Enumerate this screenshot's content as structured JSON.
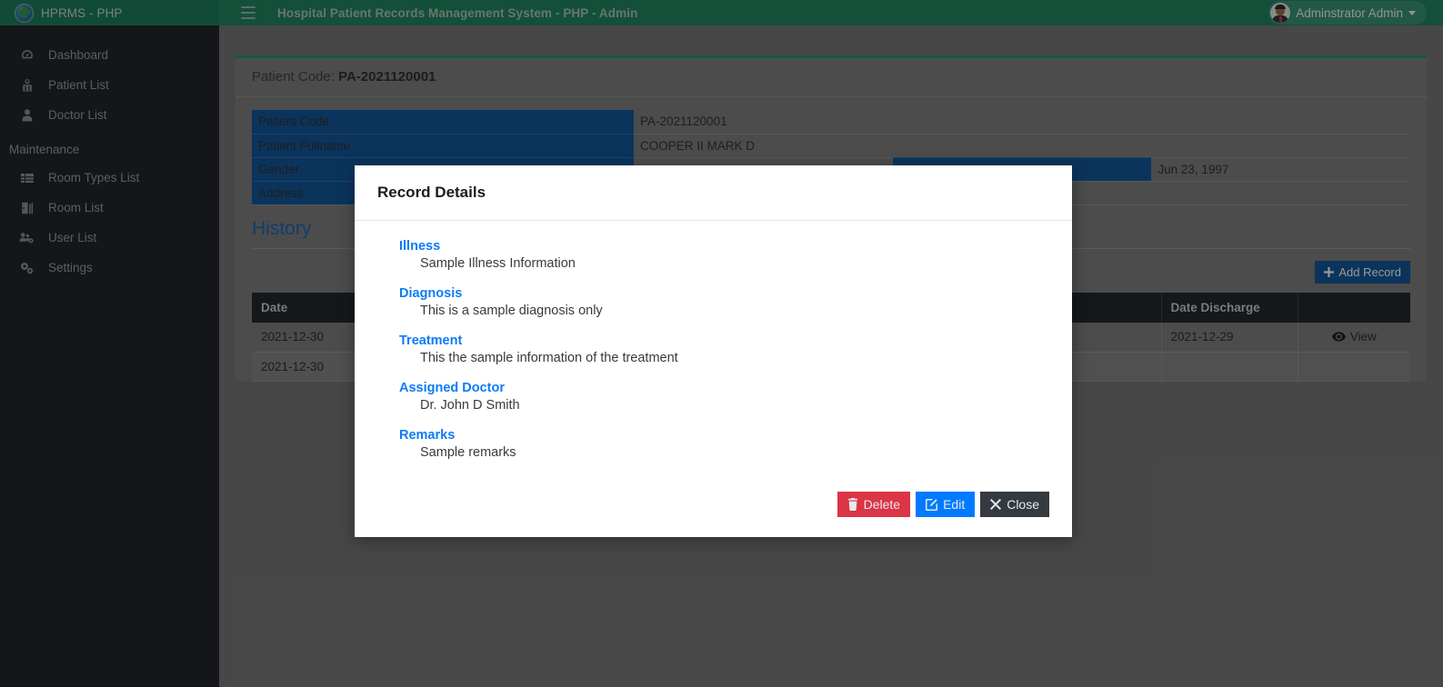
{
  "navbar": {
    "brand": "HPRMS - PHP",
    "brand_logo_icon": "hospital-logo-icon",
    "toggle_icon": "hamburger-menu-icon",
    "title": "Hospital Patient Records Management System - PHP - Admin",
    "user": "Adminstrator Admin",
    "avatar_icon": "user-avatar-icon",
    "caret_icon": "caret-down-icon",
    "bg": "#1f7a5a"
  },
  "sidebar": {
    "items": [
      {
        "label": "Dashboard",
        "icon": "tachometer-icon"
      },
      {
        "label": "Patient List",
        "icon": "hospital-user-icon"
      },
      {
        "label": "Doctor List",
        "icon": "user-icon"
      }
    ],
    "section_label": "Maintenance",
    "maintenance": [
      {
        "label": "Room Types List",
        "icon": "th-list-icon"
      },
      {
        "label": "Room List",
        "icon": "door-open-icon"
      },
      {
        "label": "User List",
        "icon": "users-cog-icon"
      },
      {
        "label": "Settings",
        "icon": "cogs-icon"
      }
    ],
    "bg": "#1f2328"
  },
  "page": {
    "header_prefix": "Patient Code:",
    "header_code": "PA-2021120001",
    "accent": "#1f8a5f",
    "details": [
      {
        "label": "Patient Code",
        "value": "PA-2021120001",
        "label2": "",
        "value2": ""
      },
      {
        "label": "Patient Fullname",
        "value": "COOPER II MARK D",
        "label2": "",
        "value2": ""
      },
      {
        "label": "Gender",
        "value": "",
        "label2": "",
        "value2": "Jun 23, 1997"
      },
      {
        "label": "Address",
        "value": "",
        "label2": "",
        "value2": ""
      }
    ],
    "history_title": "History",
    "add_record_label": "Add Record",
    "add_record_icon": "plus-icon",
    "table": {
      "columns": [
        "Date",
        "Date Discharge",
        ""
      ],
      "rows": [
        {
          "date": "2021-12-30",
          "date_discharge": "2021-12-29",
          "action": "View",
          "action_icon": "eye-icon"
        },
        {
          "date": "2021-12-30",
          "date_discharge": "",
          "action": "",
          "action_icon": ""
        }
      ]
    }
  },
  "modal": {
    "title": "Record Details",
    "fields": [
      {
        "label": "Illness",
        "value": "Sample Illness Information"
      },
      {
        "label": "Diagnosis",
        "value": "This is a sample diagnosis only"
      },
      {
        "label": "Treatment",
        "value": "This the sample information of the treatment"
      },
      {
        "label": "Assigned Doctor",
        "value": "Dr. John D Smith"
      },
      {
        "label": "Remarks",
        "value": "Sample remarks"
      }
    ],
    "buttons": {
      "delete": {
        "label": "Delete",
        "icon": "trash-icon",
        "color": "#dc3545"
      },
      "edit": {
        "label": "Edit",
        "icon": "pencil-square-icon",
        "color": "#007bff"
      },
      "close": {
        "label": "Close",
        "icon": "times-icon",
        "color": "#343a40"
      }
    }
  }
}
